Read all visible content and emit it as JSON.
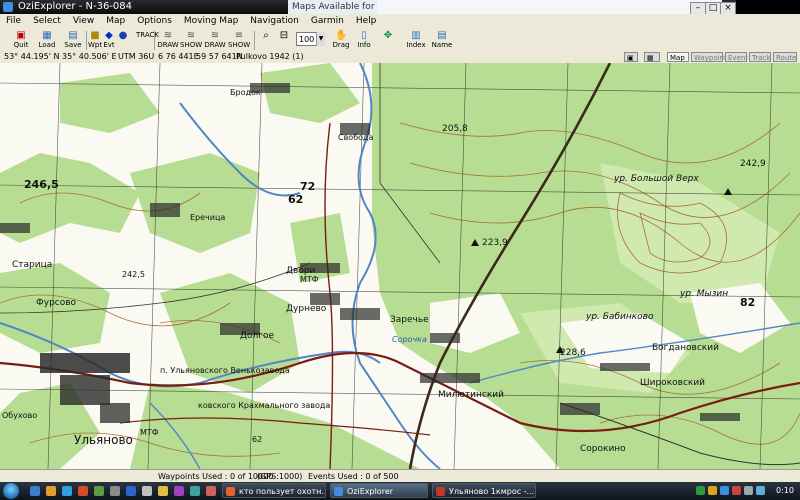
{
  "window": {
    "title": "OziExplorer - N-36-084",
    "ghost_title": "Maps Available for this Position",
    "buttons": {
      "minimize": "–",
      "maximize": "□",
      "close": "×"
    }
  },
  "menu": [
    "File",
    "Select",
    "View",
    "Map",
    "Options",
    "Moving Map",
    "Navigation",
    "Garmin",
    "Help"
  ],
  "toolbar": {
    "quit": "Quit",
    "load": "Load",
    "save": "Save",
    "wpt": "Wpt",
    "evt": "Evt",
    "track_label": "TRACK",
    "draw_label": "DRAW",
    "show_label": "SHOW",
    "zoom": "100",
    "drag": "Drag",
    "info": "Info",
    "index": "Index",
    "name": "Name"
  },
  "coords": {
    "lat": "53° 44.195' N",
    "lon": "35° 40.506' E",
    "utm": "UTM  36U",
    "east": "6 76 441E",
    "north": "59 57 641N",
    "datum": "Pulkovo 1942 (1)",
    "tabs": [
      "Map",
      "Waypoint",
      "Event",
      "Track",
      "Route"
    ]
  },
  "map_labels": {
    "ulyanovo": "Ульяново",
    "staritsa": "Старица",
    "furssovo": "Фурсово",
    "elev_2465": "246,5",
    "elev_2425": "242,5",
    "yerechitsa": "Еречица",
    "dvory": "Двори",
    "dugnevo": "Дурнево",
    "dolgoe": "Долгое",
    "zarechye": "Заречье",
    "sorochka": "Сорочка",
    "milyutinsky": "Милютинский",
    "sorokino": "Сорокино",
    "shirokovsky": "Широковский",
    "bogdanovsky": "Богдановский",
    "babinkovo": "ур. Бабинково",
    "bolshoy_verkh": "ур. Большой Верх",
    "myzin": "ур. Мызин",
    "brodok": "Бродок",
    "svobodka": "Свобода",
    "elev_2058": "205,8",
    "elev_2239": "223,9",
    "elev_2286": "228,6",
    "elev_2429": "242,9",
    "num_62a": "62",
    "num_62b": "62",
    "num_72": "72",
    "num_82": "82",
    "mtf": "МТФ",
    "factory": "п. Ульяновского Венькозавода",
    "factory2": "ковского Крахмального завода",
    "obukhovo": "Обухово",
    "mtf2": "МТФ"
  },
  "status": {
    "waypoints": "Waypoints Used : 0 of 10000",
    "gps": "(GPS:1000)",
    "events": "Events Used : 0 of 500"
  },
  "taskbar": {
    "tasks": [
      "кто пользует охотн...",
      "OziExplorer",
      "Ульяново 1кмрос -..."
    ],
    "clock": "0:10"
  },
  "colors": {
    "forest": "#b7dd93",
    "forest_light": "#cfe9ae",
    "contour": "#a35a2a",
    "river": "#4f86c8",
    "road": "#7a1c12",
    "grid": "#222222",
    "settlement": "#2b2b2b"
  }
}
